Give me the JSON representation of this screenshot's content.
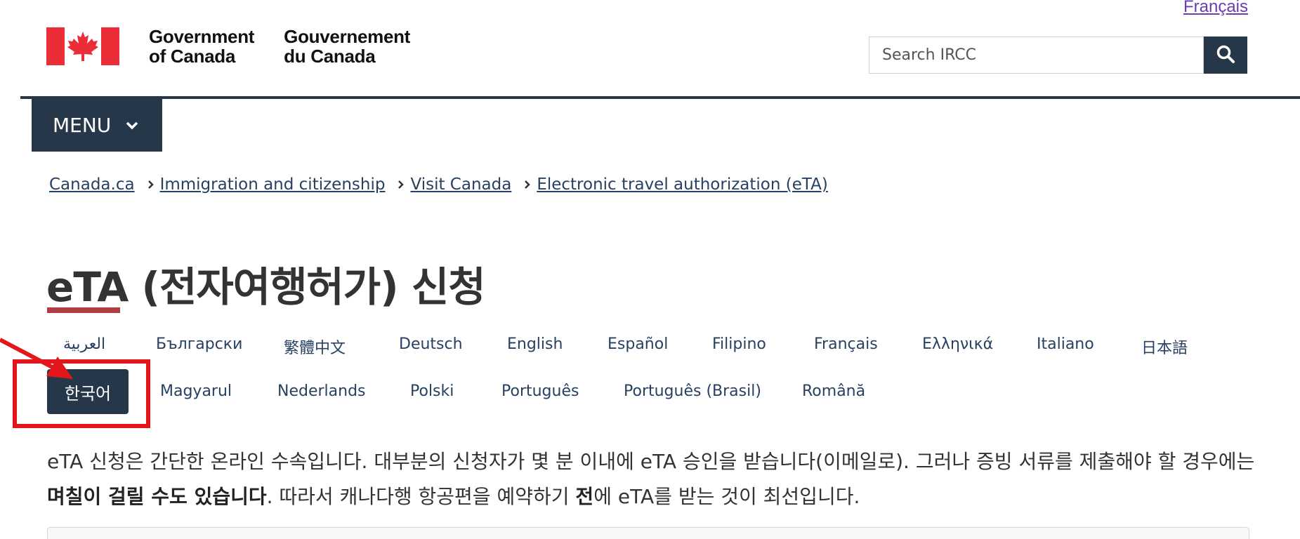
{
  "header": {
    "lang_toggle": "Français",
    "signature_en_line1": "Government",
    "signature_en_line2": "of Canada",
    "signature_fr_line1": "Gouvernement",
    "signature_fr_line2": "du Canada",
    "search_placeholder": "Search IRCC",
    "search_icon": "search-icon",
    "flag_icon": "canada-flag-icon",
    "menu_label": "MENU"
  },
  "breadcrumb": [
    "Canada.ca",
    "Immigration and citizenship",
    "Visit Canada",
    "Electronic travel authorization (eTA)"
  ],
  "title": "eTA (전자여행허가) 신청",
  "languages": {
    "row1": [
      "العربية",
      "Български",
      "繁體中文",
      "Deutsch",
      "English",
      "Español",
      "Filipino",
      "Français",
      "Ελληνικά",
      "Italiano",
      "日本語"
    ],
    "current": "한국어",
    "row2": [
      "Magyarul",
      "Nederlands",
      "Polski",
      "Português",
      "Português (Brasil)",
      "Română"
    ]
  },
  "intro": {
    "part1": "eTA 신청은 간단한 온라인 수속입니다. 대부분의 신청자가 몇 분 이내에 eTA 승인을 받습니다(이메일로). 그러나 증빙 서류를 제출해야 할 경우에는 ",
    "bold1": "며칠이 걸릴 수도 있습니다",
    "part2": ". 따라서 캐나다행 항공편을 예약하기 ",
    "bold2": "전",
    "part3": "에 eTA를 받는 것이 최선입니다."
  },
  "colors": {
    "navy": "#26374a",
    "link": "#284162",
    "visited": "#6a3db5",
    "accent_red": "#af3c43",
    "annotation_red": "#e3161b"
  }
}
